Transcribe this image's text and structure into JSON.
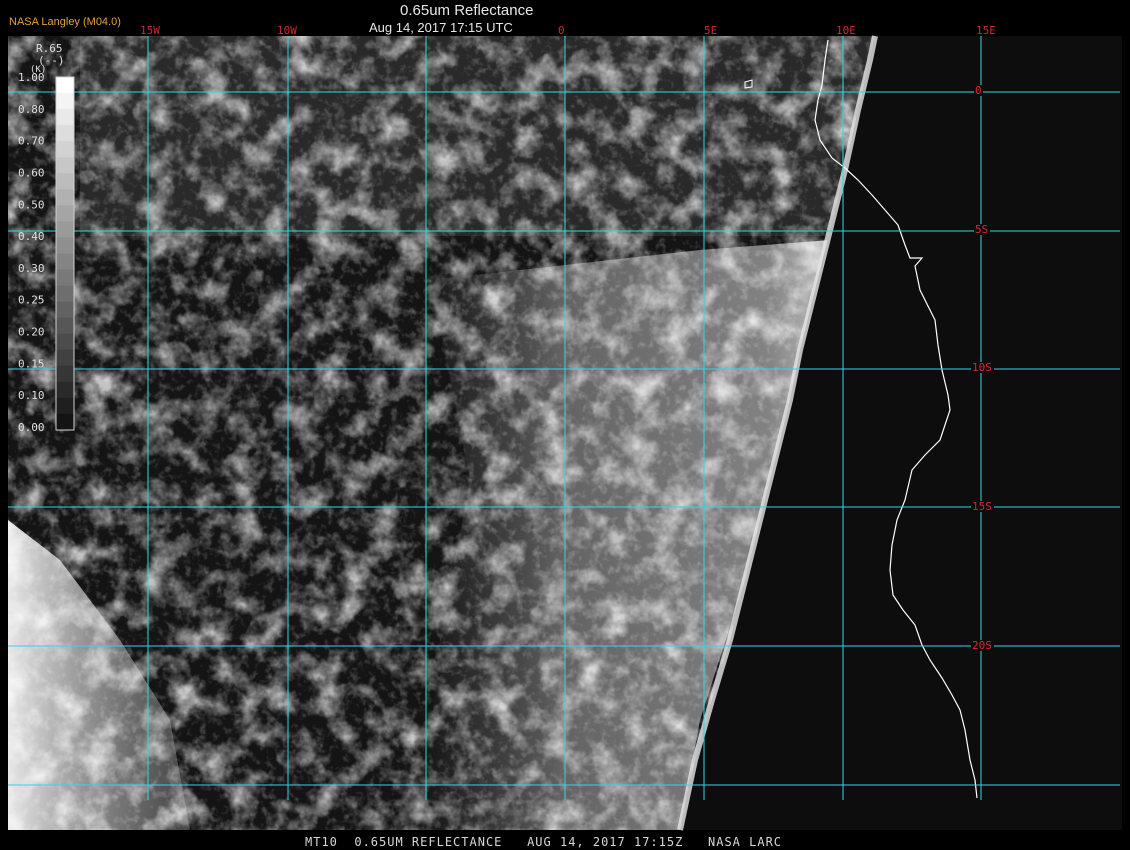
{
  "header": {
    "producer": "NASA Langley (M04.0)",
    "title": "0.65um Reflectance",
    "timestamp": "Aug 14, 2017 17:15 UTC"
  },
  "footer": {
    "caption": "MT10  0.65UM REFLECTANCE   AUG 14, 2017 17:15Z   NASA LARC"
  },
  "colorbar": {
    "title": "R.65",
    "units": "(--)",
    "corner_mark": "(K)",
    "ticks": [
      "1.00",
      "0.80",
      "0.70",
      "0.60",
      "0.50",
      "0.40",
      "0.30",
      "0.25",
      "0.20",
      "0.15",
      "0.10",
      "0.00"
    ]
  },
  "map": {
    "longitude_labels": [
      "15W",
      "10W",
      "0",
      "5E",
      "10E",
      "15E"
    ],
    "latitude_labels": [
      "0",
      "5S",
      "10S",
      "15S",
      "20S"
    ],
    "colors": {
      "gridline": "#2fd6e6",
      "grid_label": "#d4272b",
      "coastline": "#ffffff",
      "background": "#000000",
      "land": "#0d0d0d"
    }
  }
}
